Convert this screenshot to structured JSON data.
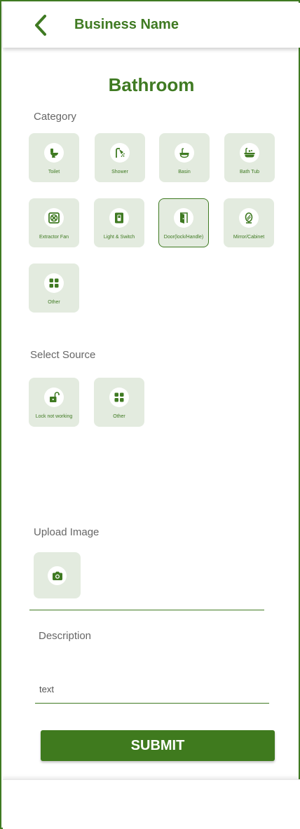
{
  "header": {
    "title": "Business Name",
    "back_icon": "chevron-left-icon"
  },
  "page": {
    "title": "Bathroom"
  },
  "category": {
    "label": "Category",
    "items": [
      {
        "label": "Toilet",
        "icon": "toilet-icon"
      },
      {
        "label": "Shower",
        "icon": "shower-icon"
      },
      {
        "label": "Basin",
        "icon": "basin-icon"
      },
      {
        "label": "Bath Tub",
        "icon": "bathtub-icon"
      },
      {
        "label": "Extractor Fan",
        "icon": "extractor-fan-icon"
      },
      {
        "label": "Light & Switch",
        "icon": "light-switch-icon"
      },
      {
        "label": "Door(lock/Handle)",
        "icon": "door-icon",
        "selected": true
      },
      {
        "label": "Mirror/Cabinet",
        "icon": "mirror-icon"
      },
      {
        "label": "Other",
        "icon": "grid-icon"
      }
    ]
  },
  "source": {
    "label": "Select Source",
    "items": [
      {
        "label": "Lock not working",
        "icon": "unlock-icon"
      },
      {
        "label": "Other",
        "icon": "grid-icon"
      }
    ]
  },
  "upload": {
    "label": "Upload Image",
    "icon": "camera-icon"
  },
  "description": {
    "label": "Description",
    "value": "text"
  },
  "submit": {
    "label": "SUBMIT"
  },
  "colors": {
    "accent": "#3f7a22",
    "tile_bg": "#e3ebdf",
    "label_gray": "#666666"
  }
}
